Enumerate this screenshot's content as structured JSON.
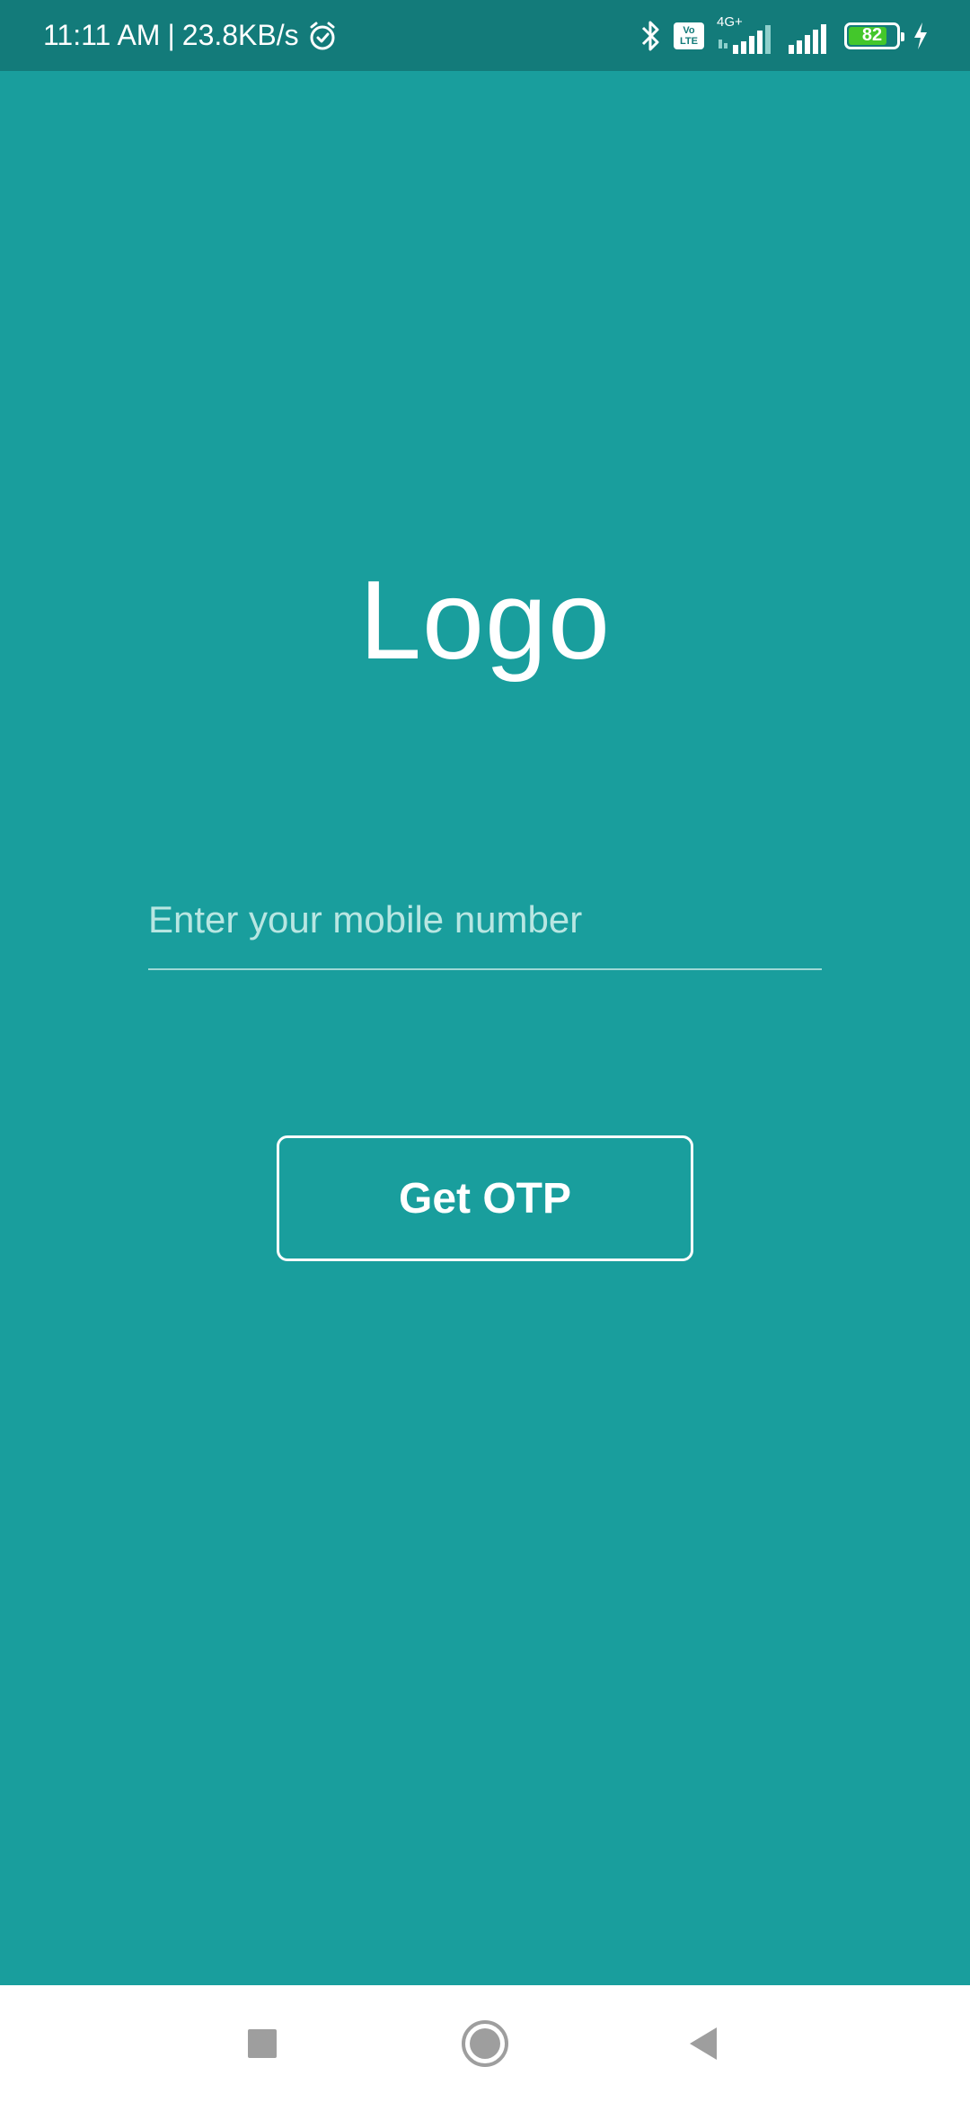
{
  "status_bar": {
    "time": "11:11 AM",
    "separator": "|",
    "speed": "23.8KB/s",
    "network_label": "4G+",
    "volte_top": "Vo",
    "volte_bottom": "LTE",
    "battery_level": "82",
    "battery_fraction": 0.82,
    "icons": [
      "alarm-icon",
      "bluetooth-icon",
      "volte-icon",
      "signal-icon",
      "signal-icon",
      "battery-icon",
      "charging-icon"
    ]
  },
  "main": {
    "logo_text": "Logo",
    "mobile_input": {
      "placeholder": "Enter your mobile number",
      "value": ""
    },
    "otp_button_label": "Get OTP"
  },
  "nav_bar": {
    "icons": [
      "recent-apps-icon",
      "home-icon",
      "back-icon"
    ]
  },
  "colors": {
    "background": "#199e9d",
    "status_bar": "#137b7a",
    "nav_bar": "#ffffff",
    "nav_icon": "#9e9e9e",
    "battery_fill": "#43c72b"
  }
}
